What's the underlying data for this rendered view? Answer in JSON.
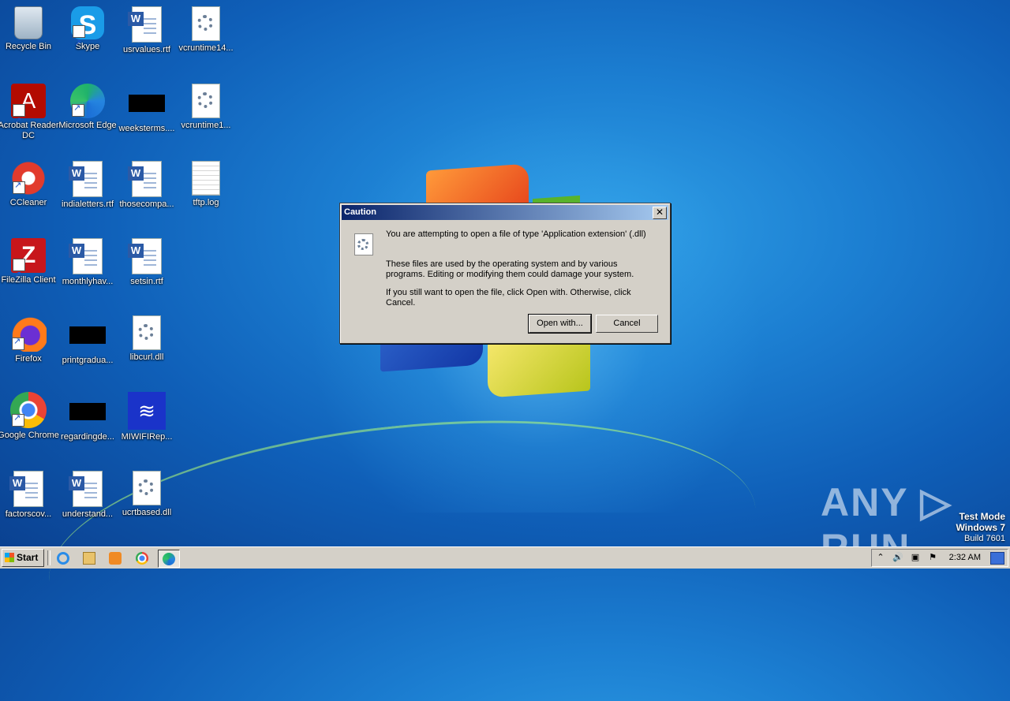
{
  "desktop": {
    "icons": [
      {
        "label": "Recycle Bin"
      },
      {
        "label": "Skype"
      },
      {
        "label": "usrvalues.rtf"
      },
      {
        "label": "vcruntime14..."
      },
      {
        "label": "Acrobat Reader DC"
      },
      {
        "label": "Microsoft Edge"
      },
      {
        "label": "weeksterms...."
      },
      {
        "label": "vcruntime1..."
      },
      {
        "label": "CCleaner"
      },
      {
        "label": "indialetters.rtf"
      },
      {
        "label": "thosecompa..."
      },
      {
        "label": "tftp.log"
      },
      {
        "label": "FileZilla Client"
      },
      {
        "label": "monthlyhav..."
      },
      {
        "label": "setsin.rtf"
      },
      {
        "label": "Firefox"
      },
      {
        "label": "printgradua..."
      },
      {
        "label": "libcurl.dll"
      },
      {
        "label": "Google Chrome"
      },
      {
        "label": "regardingde..."
      },
      {
        "label": "MIWIFIRep..."
      },
      {
        "label": "factorscov..."
      },
      {
        "label": "understand..."
      },
      {
        "label": "ucrtbased.dll"
      }
    ]
  },
  "dialog": {
    "title": "Caution",
    "close_glyph": "✕",
    "message1": "You are attempting to open a file of type 'Application extension' (.dll)",
    "message2": "These files are used by the operating system and by various programs. Editing or modifying them could damage your system.",
    "message3": "If you still want to open the file, click Open with. Otherwise, click Cancel.",
    "open_with_label": "Open with...",
    "cancel_label": "Cancel"
  },
  "watermark": {
    "text": "ANY ▷ RUN",
    "line1": "Test Mode",
    "line2": "Windows 7",
    "line3": "Build 7601"
  },
  "taskbar": {
    "start_label": "Start",
    "apps": [
      {
        "name": "internet-explorer-icon"
      },
      {
        "name": "file-explorer-icon"
      },
      {
        "name": "media-player-icon"
      },
      {
        "name": "chrome-icon"
      },
      {
        "name": "edge-icon"
      }
    ],
    "clock": "2:32 AM",
    "tray_icons": [
      "chevron-up-icon",
      "volume-icon",
      "network-icon",
      "flag-icon"
    ],
    "tray_glyphs": {
      "chevron": "⌃",
      "volume": "🔊",
      "network": "▣",
      "flag": "⚑"
    }
  }
}
